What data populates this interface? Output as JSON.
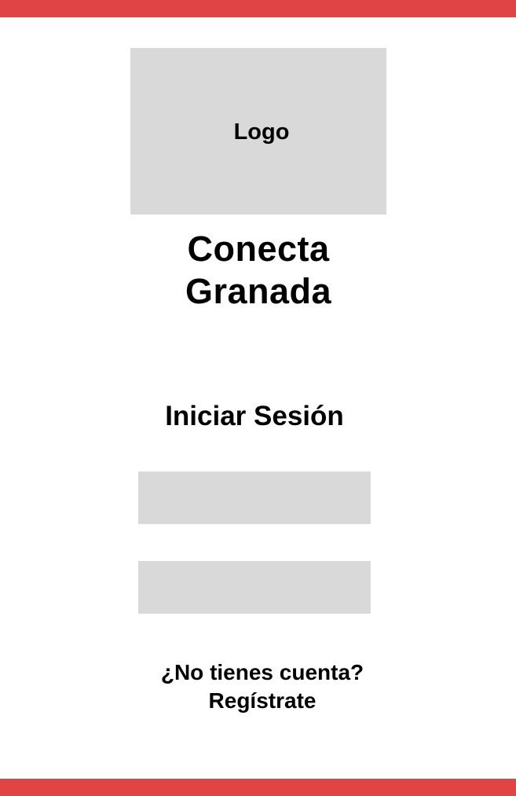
{
  "colors": {
    "accent_bar": "#e04444",
    "placeholder_gray": "#d9d9d9",
    "text": "#000000",
    "background": "#ffffff"
  },
  "logo": {
    "label": "Logo"
  },
  "app": {
    "title_line1": "Conecta",
    "title_line2": "Granada"
  },
  "login": {
    "heading": "Iniciar Sesión",
    "fields": [
      {
        "value": "",
        "placeholder": ""
      },
      {
        "value": "",
        "placeholder": ""
      }
    ]
  },
  "register": {
    "prompt": "¿No tienes cuenta?",
    "link_label": "Regístrate"
  }
}
